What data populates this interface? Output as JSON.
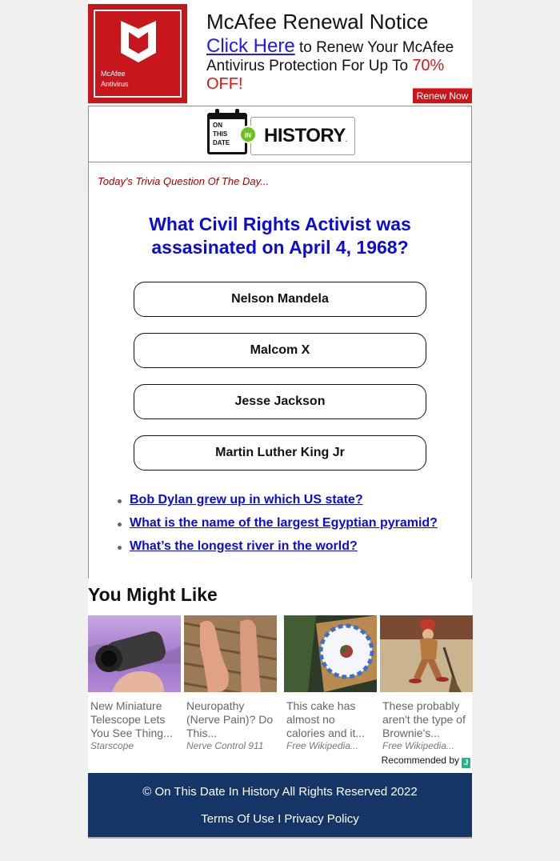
{
  "ad": {
    "logo_text_line1": "McAfee",
    "logo_text_line2": "Antivirus",
    "title": "McAfee Renewal Notice",
    "click_label": "Click Here",
    "body_part1": " to Renew Your McAfee Antivirus Protection For Up To ",
    "discount": "70% OFF!",
    "renew_button": "Renew Now",
    "brand_color": "#c8171c"
  },
  "brand": {
    "calendar_text": [
      "ON",
      "THIS",
      "DATE"
    ],
    "in_badge": "IN",
    "history": "HISTORY",
    "history_dot": "."
  },
  "trivia": {
    "intro": "Today's Trivia Question Of The Day...",
    "question": "What Civil Rights Activist was assasinated on April 4, 1968?",
    "answers": [
      "Nelson Mandela",
      "Malcom X",
      "Jesse Jackson",
      "Martin Luther King Jr"
    ],
    "related": [
      "Bob Dylan grew up in which US state?",
      "What is the name of the largest Egyptian pyramid?",
      "What’s the longest river in the world?"
    ]
  },
  "you_might_like": {
    "title": "You Might Like",
    "items": [
      {
        "text": "New Miniature Telescope Lets You See Thing...",
        "source": "Starscope",
        "image": "monocular-telescope-in-hand"
      },
      {
        "text": "Neuropathy (Nerve Pain)? Do This...",
        "source": "Nerve Control 911",
        "image": "bare-feet-on-wood-deck"
      },
      {
        "text": "This cake has almost no calories and it...",
        "source": "Free Wikipedia...",
        "image": "dessert-plate-on-board"
      },
      {
        "text": "These probably aren't the type of Brownie's...",
        "source": "Free Wikipedia...",
        "image": "brownie-elf-illustration"
      }
    ],
    "recommended_by": "Recommended by",
    "recommended_logo": "J"
  },
  "footer": {
    "copyright": "© On This Date In History All Rights Reserved 2022",
    "terms": "Terms Of Use",
    "separator": " I ",
    "privacy": "Privacy Policy"
  }
}
